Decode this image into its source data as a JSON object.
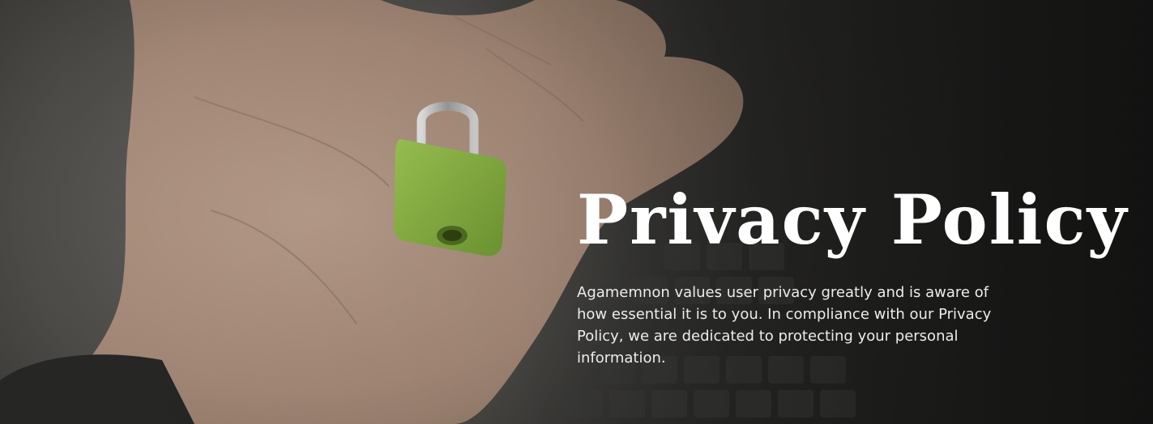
{
  "hero": {
    "title": "Privacy Policy",
    "description": "Agamemnon values user privacy greatly and is aware of how essential it is to you. In compliance with our Privacy Policy, we are dedicated to protecting your personal information.",
    "image": "hand-holding-green-padlock-over-keyboard"
  },
  "colors": {
    "padlock": "#8cb442",
    "title": "#ffffff",
    "text": "#ececec"
  }
}
